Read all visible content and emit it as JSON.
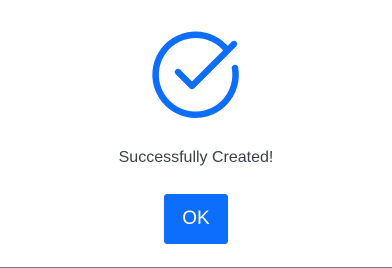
{
  "dialog": {
    "icon": "check-circle-icon",
    "icon_color": "#0d6efd",
    "message": "Successfully Created!",
    "ok_label": "OK",
    "ok_color": "#0d6efd"
  }
}
